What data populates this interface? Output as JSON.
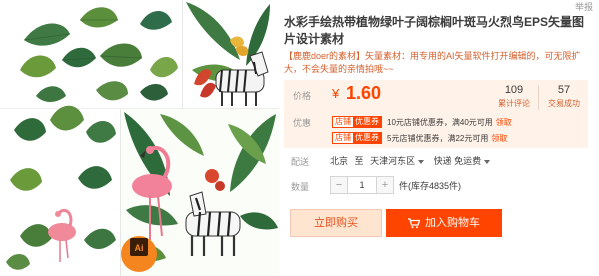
{
  "header": {
    "report_label": "举报"
  },
  "product": {
    "title": "水彩手绘热带植物绿叶子阔棕榈叶斑马火烈鸟EPS矢量图片设计素材",
    "subtitle": "【鹿鹿doer的素材】矢量素材：用专用的AI矢量软件打开编辑的，可无限扩大，不会失量的亲情拍哦~~",
    "image_badge": "Ai"
  },
  "price": {
    "label": "价格",
    "currency": "¥",
    "value": "1.60",
    "reviews": {
      "count": "109",
      "caption": "累计评论"
    },
    "sales": {
      "count": "57",
      "caption": "交易成功"
    }
  },
  "promotions": {
    "label": "优惠",
    "items": [
      {
        "tag_store": "店铺",
        "tag_coupon": "优惠券",
        "text": "10元店铺优惠券，满40元可用",
        "link": "领取"
      },
      {
        "tag_store": "店铺",
        "tag_coupon": "优惠券",
        "text": "5元店铺优惠券，满22元可用",
        "link": "领取"
      }
    ]
  },
  "shipping": {
    "label": "配送",
    "origin": "北京",
    "to_word": "至",
    "destination": "天津河东区",
    "method": "快递 免运费"
  },
  "quantity": {
    "label": "数量",
    "minus": "−",
    "value": "1",
    "plus": "+",
    "unit_stock": "件(库存4835件)"
  },
  "actions": {
    "buy_now": "立即购买",
    "add_to_cart": "加入购物车"
  },
  "colors": {
    "accent": "#ff4400",
    "price_bg": "#fff2e8",
    "buy_now_bg": "#ffe4d0"
  }
}
